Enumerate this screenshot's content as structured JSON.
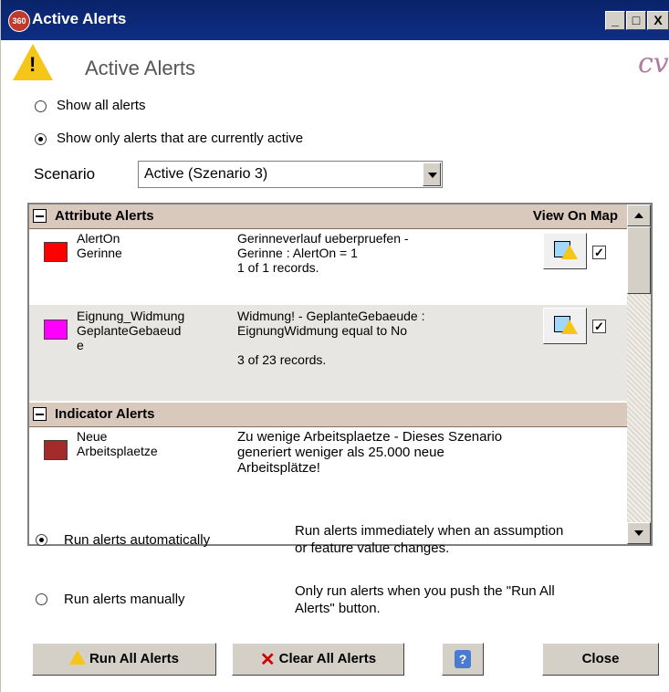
{
  "window": {
    "app_icon_text": "360",
    "title": "Active Alerts",
    "controls": [
      "_",
      "□",
      "X"
    ]
  },
  "header": {
    "title": "Active Alerts",
    "logo_text": "cv"
  },
  "filter": {
    "show_all_label": "Show all alerts",
    "show_active_label": "Show only alerts that are currently active",
    "selected": "show_active"
  },
  "scenario": {
    "label": "Scenario",
    "selected": "Active (Szenario 3)"
  },
  "alerts_list": {
    "view_on_map_label": "View On Map",
    "groups": [
      {
        "title": "Attribute Alerts",
        "rows": [
          {
            "name_line1": "AlertOn",
            "name_line2": "Gerinne",
            "name_line3": "",
            "color": "#ff0000",
            "desc_line1": "Gerinneverlauf ueberpruefen -",
            "desc_line2": "Gerinne : AlertOn = 1",
            "desc_line3": "1 of 1 records.",
            "checked": true
          },
          {
            "name_line1": "Eignung_Widmung",
            "name_line2": "GeplanteGebaeud",
            "name_line3": "e",
            "color": "#ff00ff",
            "desc_line1": "Widmung! - GeplanteGebaeude :",
            "desc_line2": "EignungWidmung equal to No",
            "desc_line3": "3 of 23 records.",
            "checked": true
          }
        ]
      },
      {
        "title": "Indicator Alerts",
        "rows": [
          {
            "name_line1": "Neue",
            "name_line2": "Arbeitsplaetze",
            "color": "#a52a2a",
            "desc_line1": "Zu wenige Arbeitsplaetze - Dieses Szenario",
            "desc_line2": "generiert weniger als 25.000 neue",
            "desc_line3": "Arbeitsplätze!"
          }
        ]
      }
    ]
  },
  "run_mode": {
    "selected": "automatic",
    "auto_label": "Run alerts automatically",
    "auto_desc_line1": "Run alerts immediately when an assumption",
    "auto_desc_line2": "or feature value changes.",
    "manual_label": "Run alerts manually",
    "manual_desc_line1": "Only run alerts when you push the \"Run All",
    "manual_desc_line2": "Alerts\" button."
  },
  "buttons": {
    "run_all": "Run All Alerts",
    "clear_all": "Clear All Alerts",
    "help": "?",
    "close": "Close"
  }
}
